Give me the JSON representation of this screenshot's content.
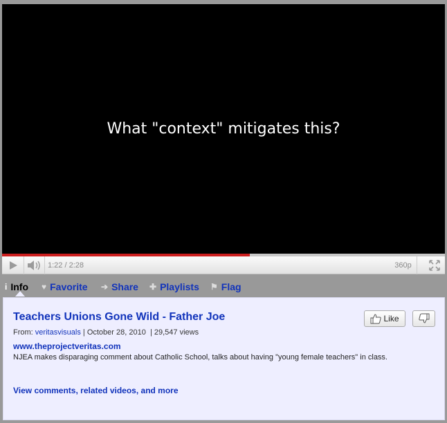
{
  "player": {
    "caption": "What \"context\" mitigates this?",
    "progress": 0.56,
    "time": "1:22 / 2:28",
    "quality": "360p"
  },
  "tabs": [
    {
      "label": "Info",
      "icon": "info-icon",
      "active": true
    },
    {
      "label": "Favorite",
      "icon": "heart-icon"
    },
    {
      "label": "Share",
      "icon": "arrow-right-icon"
    },
    {
      "label": "Playlists",
      "icon": "plus-icon"
    },
    {
      "label": "Flag",
      "icon": "flag-icon"
    }
  ],
  "info": {
    "title": "Teachers Unions Gone Wild - Father Joe",
    "from_label": "From:",
    "author": "veritasvisuals",
    "date": "October 28, 2010",
    "views": "29,547 views",
    "site_link": "www.theprojectveritas.com",
    "description": "NJEA makes disparaging comment about Catholic School, talks about having \"young female teachers\" in class.",
    "more_link": "View comments, related videos, and more",
    "like_label": "Like"
  },
  "colors": {
    "accent_link": "#1133bb",
    "progress": "#cc1e1e",
    "panel_bg": "#eeeeff",
    "page_bg": "#999999"
  }
}
